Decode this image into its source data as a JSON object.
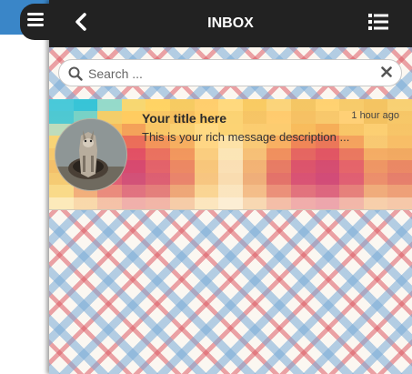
{
  "header": {
    "title": "INBOX",
    "back_icon": "chevron-left-icon",
    "list_icon": "list-icon",
    "menu_icon": "hamburger-menu-icon"
  },
  "search": {
    "placeholder": "Search ...",
    "value": "",
    "icon": "search-icon",
    "clear_icon": "close-icon"
  },
  "messages": [
    {
      "title": "Your title here",
      "time": "1 hour ago",
      "description": "This is your rich message description ..."
    }
  ],
  "colors": {
    "header_bg": "#222222",
    "header_text": "#ffffff",
    "left_accent": "#3a86c8",
    "plaid_blue": "#78aad7",
    "plaid_red": "#dc5a64"
  }
}
